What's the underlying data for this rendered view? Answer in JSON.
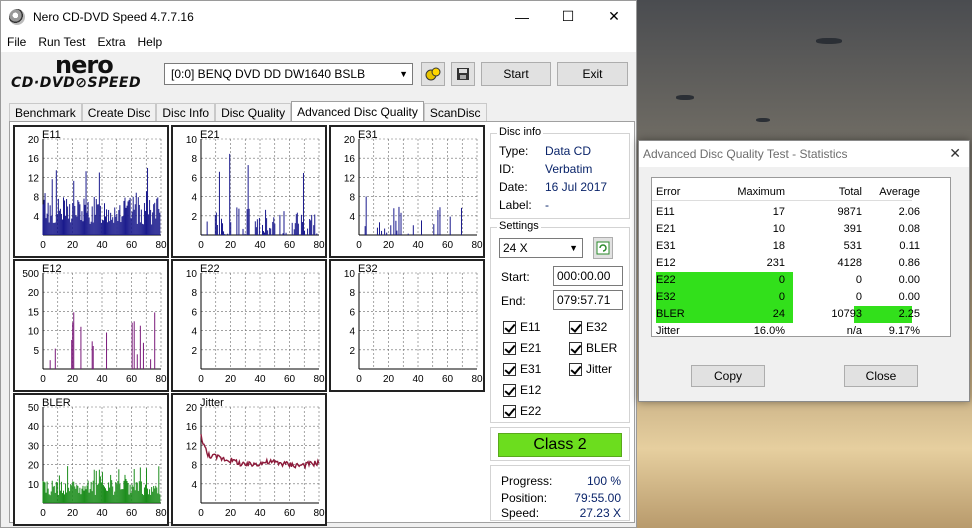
{
  "window": {
    "title": "Nero CD-DVD Speed 4.7.7.16",
    "minimize": "—",
    "maximize": "☐",
    "close": "✕"
  },
  "menu": [
    "File",
    "Run Test",
    "Extra",
    "Help"
  ],
  "logo": {
    "line1": "nero",
    "line2": "CD·DVD⊘SPEED"
  },
  "toolbar": {
    "drive": "[0:0]   BENQ DVD DD DW1640 BSLB",
    "start": "Start",
    "exit": "Exit"
  },
  "tabs": [
    "Benchmark",
    "Create Disc",
    "Disc Info",
    "Disc Quality",
    "Advanced Disc Quality",
    "ScanDisc"
  ],
  "active_tab": "Advanced Disc Quality",
  "disc_info": {
    "title": "Disc info",
    "type_k": "Type:",
    "type_v": "Data CD",
    "id_k": "ID:",
    "id_v": "Verbatim",
    "date_k": "Date:",
    "date_v": "16 Jul 2017",
    "label_k": "Label:",
    "label_v": "-"
  },
  "settings": {
    "title": "Settings",
    "speed": "24 X",
    "start_k": "Start:",
    "start_v": "000:00.00",
    "end_k": "End:",
    "end_v": "079:57.71",
    "checks": [
      "E11",
      "E32",
      "E21",
      "BLER",
      "E31",
      "Jitter",
      "E12",
      "E22"
    ]
  },
  "class": "Class 2",
  "progress": {
    "progress_k": "Progress:",
    "progress_v": "100 %",
    "position_k": "Position:",
    "position_v": "79:55.00",
    "speed_k": "Speed:",
    "speed_v": "27.23 X"
  },
  "plots": [
    {
      "name": "E11",
      "yticks": [
        "20",
        "16",
        "12",
        "8",
        "4"
      ],
      "color": "#1a1a8c"
    },
    {
      "name": "E21",
      "yticks": [
        "10",
        "8",
        "6",
        "4",
        "2"
      ],
      "color": "#1a1a8c"
    },
    {
      "name": "E31",
      "yticks": [
        "20",
        "16",
        "12",
        "8",
        "4"
      ],
      "color": "#1a1a8c"
    },
    {
      "name": "E12",
      "yticks": [
        "500",
        "20",
        "15",
        "10",
        "5"
      ],
      "color": "#7a1a7a"
    },
    {
      "name": "E22",
      "yticks": [
        "10",
        "8",
        "6",
        "4",
        "2"
      ],
      "color": "#1a1a8c"
    },
    {
      "name": "E32",
      "yticks": [
        "10",
        "8",
        "6",
        "4",
        "2"
      ],
      "color": "#1a1a8c"
    },
    {
      "name": "BLER",
      "yticks": [
        "50",
        "40",
        "30",
        "20",
        "10"
      ],
      "color": "#1a8c1a"
    },
    {
      "name": "Jitter",
      "yticks": [
        "20",
        "16",
        "12",
        "8",
        "4"
      ],
      "color": "#8c1a3a"
    }
  ],
  "xticks": [
    "0",
    "20",
    "40",
    "60",
    "80"
  ],
  "stats": {
    "title": "Advanced Disc Quality Test - Statistics",
    "close": "✕",
    "headers": [
      "Error",
      "Maximum",
      "Total",
      "Average"
    ],
    "rows": [
      {
        "error": "E11",
        "max": "17",
        "total": "9871",
        "avg": "2.06"
      },
      {
        "error": "E21",
        "max": "10",
        "total": "391",
        "avg": "0.08"
      },
      {
        "error": "E31",
        "max": "18",
        "total": "531",
        "avg": "0.11"
      },
      {
        "error": "E12",
        "max": "231",
        "total": "4128",
        "avg": "0.86"
      },
      {
        "error": "E22",
        "max": "0",
        "total": "0",
        "avg": "0.00"
      },
      {
        "error": "E32",
        "max": "0",
        "total": "0",
        "avg": "0.00"
      },
      {
        "error": "BLER",
        "max": "24",
        "total": "10793",
        "avg": "2.25"
      },
      {
        "error": "Jitter",
        "max": "16.0%",
        "total": "n/a",
        "avg": "9.17%"
      }
    ],
    "copy": "Copy",
    "close_btn": "Close"
  }
}
